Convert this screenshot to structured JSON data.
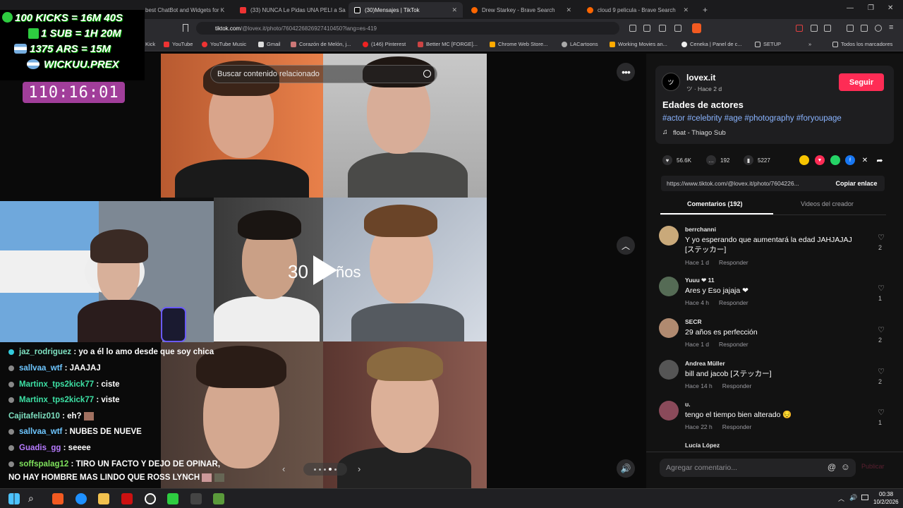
{
  "browser": {
    "tabs": [
      {
        "label": "best ChatBot and Widgets for K",
        "active": false
      },
      {
        "label": "(33) NUNCA Le Pidas UNA PELI a Sa",
        "active": false
      },
      {
        "label": "(30)Mensajes | TikTok",
        "active": true
      },
      {
        "label": "Drew Starkey - Brave Search",
        "active": false
      },
      {
        "label": "cloud 9 pelicula - Brave Search",
        "active": false
      }
    ],
    "url_host": "tiktok.com",
    "url_path": "/@lovex.it/photo/7604226826927410450?lang=es-419",
    "bookmarks": [
      "Kick",
      "YouTube",
      "YouTube Music",
      "Gmail",
      "Corazón de Melón, j...",
      "(146) Pinterest",
      "Better MC [FORGE]...",
      "Chrome Web Store...",
      "LACartoons",
      "Working Movies an...",
      "Ceneka | Panel de c...",
      "SETUP",
      "Todos los marcadores"
    ]
  },
  "stream": {
    "stats": [
      "100 KICKS = 16M 40S",
      "1 SUB = 1H 20M",
      "1375 ARS = 15M",
      "WICKUU.PREX"
    ],
    "timer": "110:16:01"
  },
  "chat": [
    {
      "user": "jaz_rodriguez",
      "color": "#7ee0c0",
      "msg": "yo a él lo amo desde que soy chica"
    },
    {
      "user": "sallvaa_wtf",
      "color": "#6ec6ff",
      "msg": "JAAJAJ"
    },
    {
      "user": "Martinx_tps2kick77",
      "color": "#3de0a4",
      "msg": "ciste"
    },
    {
      "user": "Martinx_tps2kick77",
      "color": "#3de0a4",
      "msg": "viste"
    },
    {
      "user": "Cajitafeliz010",
      "color": "#7ee0c0",
      "msg": "eh?"
    },
    {
      "user": "sallvaa_wtf",
      "color": "#6ec6ff",
      "msg": "NUBES DE NUEVE"
    },
    {
      "user": "Guadis_gg",
      "color": "#b77bff",
      "msg": "seeee"
    },
    {
      "user": "soffspalag12",
      "color": "#7ee05c",
      "msg": "TIRO UN FACTO Y DEJO DE OPINAR,"
    },
    {
      "user": "",
      "color": "#fff",
      "msg": "NO HAY HOMBRE MAS LINDO QUE ROSS LYNCH"
    }
  ],
  "media": {
    "search_placeholder": "Buscar contenido relacionado",
    "overlay_text_left": "30",
    "overlay_text_right": "ños",
    "dots_count": 5,
    "dots_active": 3
  },
  "post": {
    "username": "lovex.it",
    "meta": "ツ · Hace 2 d",
    "follow": "Seguir",
    "title": "Edades de actores",
    "hashtags": "#actor #celebrity #age #photography #foryoupage",
    "music": "float - Thiago Sub",
    "likes": "56.6K",
    "comments_count": "192",
    "saves": "5227",
    "link": "https://www.tiktok.com/@lovex.it/photo/7604226...",
    "copy_label": "Copiar enlace",
    "tab_comments": "Comentarios (192)",
    "tab_videos": "Videos del creador",
    "compose_placeholder": "Agregar comentario...",
    "publish_label": "Publicar"
  },
  "comments": [
    {
      "user": "berrchanni",
      "text": "Y yo esperando que aumentará la edad JAHJAJAJ [ステッカー]",
      "time": "Hace 1 d",
      "reply": "Responder",
      "likes": "2",
      "color": "#c9a97a"
    },
    {
      "user": "Yuuu ❤ 11",
      "text": "Ares y Eso jajaja ❤",
      "time": "Hace 4 h",
      "reply": "Responder",
      "likes": "1",
      "color": "#556b55"
    },
    {
      "user": "SECR",
      "text": "29 años es perfección",
      "time": "Hace 1 d",
      "reply": "Responder",
      "likes": "2",
      "color": "#b08a70"
    },
    {
      "user": "Andrea Müller",
      "text": "bill and jacob [ステッカー]",
      "time": "Hace 14 h",
      "reply": "Responder",
      "likes": "2",
      "color": "#555"
    },
    {
      "user": "ʊ.",
      "text": "tengo el tiempo bien alterado 😔",
      "time": "Hace 22 h",
      "reply": "Responder",
      "likes": "1",
      "color": "#8a4a5a"
    },
    {
      "user": "Lucía López",
      "text": "",
      "time": "",
      "reply": "",
      "likes": "",
      "color": "#666"
    }
  ],
  "taskbar": {
    "time": "00:38",
    "date": "10/2/2026"
  }
}
